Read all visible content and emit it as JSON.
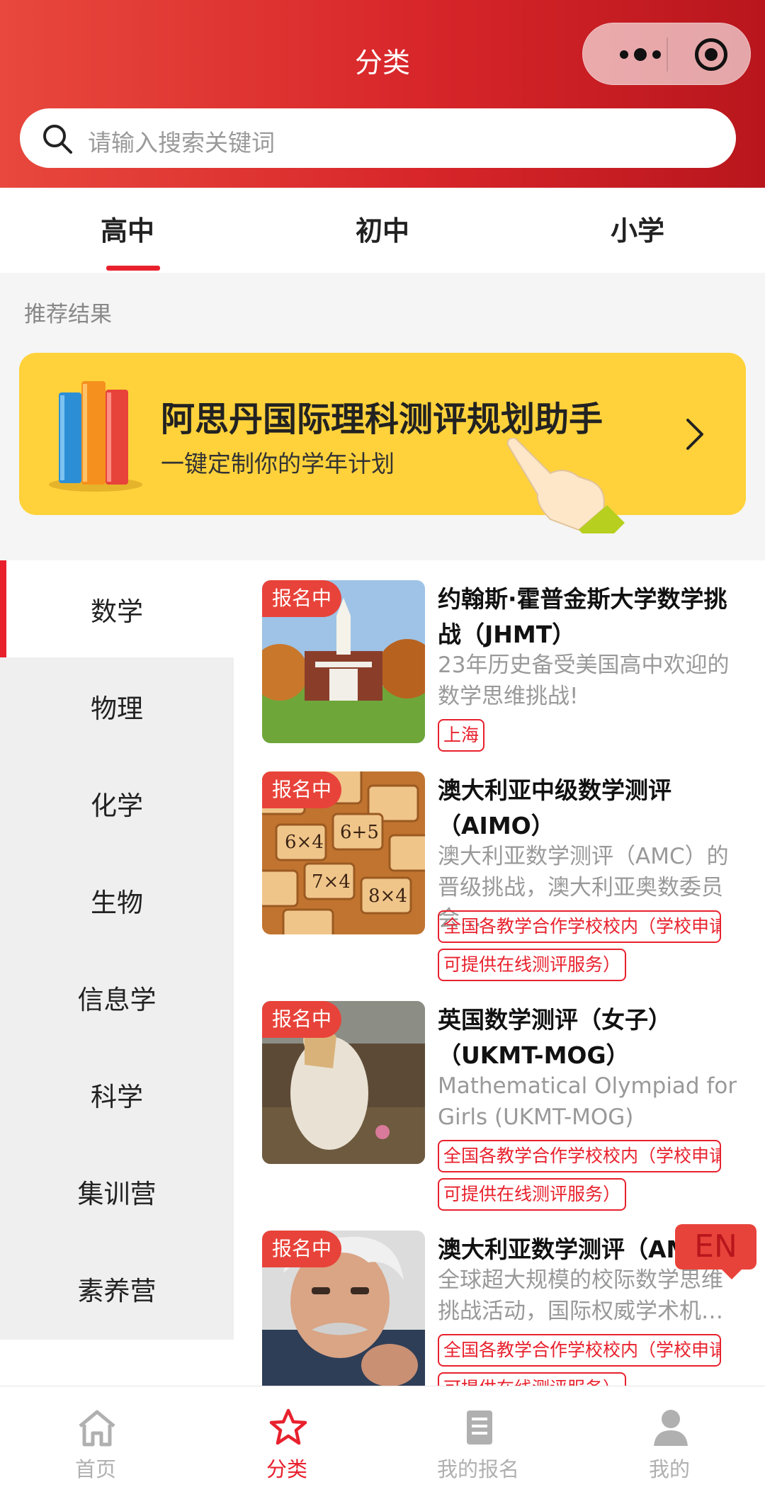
{
  "header": {
    "title": "分类",
    "search_placeholder": "请输入搜索关键词"
  },
  "level_tabs": [
    {
      "label": "高中",
      "active": true
    },
    {
      "label": "初中",
      "active": false
    },
    {
      "label": "小学",
      "active": false
    }
  ],
  "recommend": {
    "heading": "推荐结果",
    "banner_title": "阿思丹国际理科测评规划助手",
    "banner_subtitle": "一键定制你的学年计划"
  },
  "subjects": [
    "数学",
    "物理",
    "化学",
    "生物",
    "信息学",
    "科学",
    "集训营",
    "素养营"
  ],
  "active_subject": "数学",
  "cards": [
    {
      "badge": "报名中",
      "title": "约翰斯·霍普金斯大学数学挑战（JHMT）",
      "desc": "23年历史备受美国高中欢迎的数学思维挑战!",
      "tags": [
        "上海"
      ],
      "image": "university-building"
    },
    {
      "badge": "报名中",
      "title": "澳大利亚中级数学测评（AIMO）",
      "desc": "澳大利亚数学测评（AMC）的晋级挑战，澳大利亚奥数委员会…",
      "tags": [
        "全国各教学合作学校校内（学校申请",
        "可提供在线测评服务）"
      ],
      "image": "math-tiles"
    },
    {
      "badge": "报名中",
      "title": "英国数学测评（女子）（UKMT-MOG）",
      "desc": "Mathematical Olympiad for Girls (UKMT-MOG)",
      "tags": [
        "全国各教学合作学校校内（学校申请",
        "可提供在线测评服务）"
      ],
      "image": "painting"
    },
    {
      "badge": "报名中",
      "title": "澳大利亚数学测评（AM",
      "desc": "全球超大规模的校际数学思维挑战活动，国际权威学术机…",
      "tags": [
        "全国各教学合作学校校内（学校申请",
        "可提供在线测评服务）"
      ],
      "image": "portrait"
    }
  ],
  "floating_lang": "EN",
  "bottom_nav": [
    {
      "label": "首页",
      "icon": "home-icon",
      "active": false
    },
    {
      "label": "分类",
      "icon": "star-icon",
      "active": true
    },
    {
      "label": "我的报名",
      "icon": "document-icon",
      "active": false
    },
    {
      "label": "我的",
      "icon": "user-icon",
      "active": false
    }
  ],
  "colors": {
    "accent": "#e8212d",
    "banner": "#ffd23b",
    "header_start": "#e8483d",
    "header_end": "#b8161d"
  }
}
